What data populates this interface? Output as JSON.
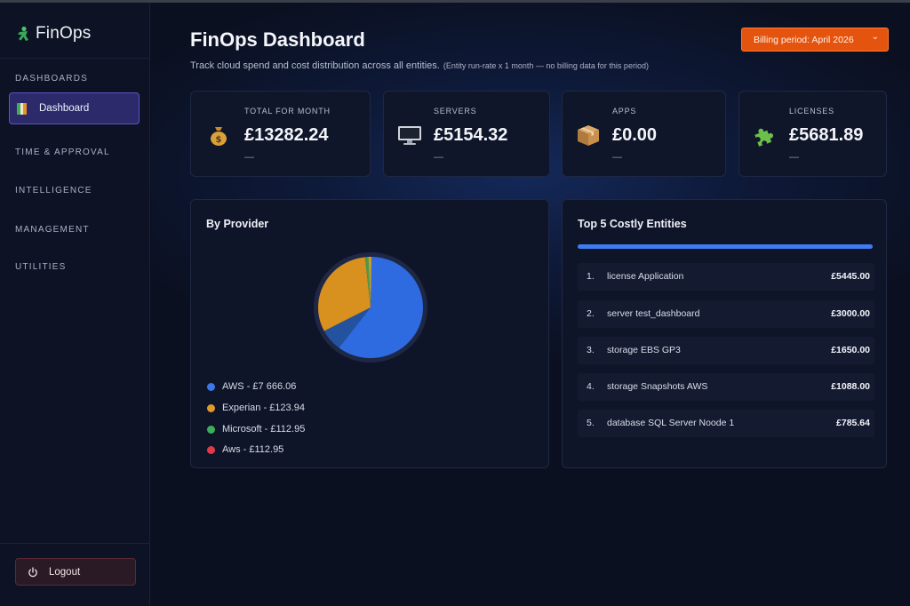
{
  "app": {
    "name": "FinOps"
  },
  "sidebar": {
    "sections": [
      "DASHBOARDS",
      "TIME & APPROVAL",
      "INTELLIGENCE",
      "MANAGEMENT",
      "UTILITIES"
    ],
    "active_item": "Dashboard",
    "logout_label": "Logout"
  },
  "header": {
    "title": "FinOps Dashboard",
    "subtitle": "Track cloud spend and cost distribution across all entities.",
    "subtitle_note": "(Entity run-rate x 1 month — no billing data for this period)",
    "billing_label": "Billing period: April 2026",
    "billing_chevron": "⌄"
  },
  "cards": [
    {
      "label": "TOTAL FOR MONTH",
      "value": "£13282.24",
      "sub": "—",
      "icon": "money-bag-icon"
    },
    {
      "label": "SERVERS",
      "value": "£5154.32",
      "sub": "—",
      "icon": "monitor-icon"
    },
    {
      "label": "APPS",
      "value": "£0.00",
      "sub": "—",
      "icon": "package-icon"
    },
    {
      "label": "LICENSES",
      "value": "£5681.89",
      "sub": "—",
      "icon": "puzzle-icon"
    }
  ],
  "provider_panel": {
    "title": "By Provider",
    "legend": [
      {
        "label": "AWS - £7 666.06",
        "color": "#3b78e7"
      },
      {
        "label": "Experian - £123.94",
        "color": "#e09a2a"
      },
      {
        "label": "Microsoft - £112.95",
        "color": "#3fae5a"
      },
      {
        "label": "Aws - £112.95",
        "color": "#e0394a"
      }
    ]
  },
  "pie_slices": [
    {
      "name": "blue",
      "fraction": 0.6,
      "color": "#2f6be0"
    },
    {
      "name": "dark-blue",
      "fraction": 0.07,
      "color": "#23529e"
    },
    {
      "name": "orange",
      "fraction": 0.31,
      "color": "#d8901f"
    },
    {
      "name": "green",
      "fraction": 0.01,
      "color": "#4a9a4c"
    },
    {
      "name": "gold",
      "fraction": 0.01,
      "color": "#c0a030"
    }
  ],
  "entities_panel": {
    "title": "Top 5 Costly Entities",
    "progress": 1.0,
    "rows": [
      {
        "rank": "1.",
        "name": "license Application",
        "amount": "£5445.00"
      },
      {
        "rank": "2.",
        "name": "server test_dashboard",
        "amount": "£3000.00"
      },
      {
        "rank": "3.",
        "name": "storage EBS GP3",
        "amount": "£1650.00"
      },
      {
        "rank": "4.",
        "name": "storage Snapshots AWS",
        "amount": "£1088.00"
      },
      {
        "rank": "5.",
        "name": "database SQL Server Noode 1",
        "amount": "£785.64"
      }
    ]
  },
  "colors": {
    "accent": "#e4540f",
    "active_nav": "#2d2a6b",
    "progress": "#3f7cf0"
  }
}
